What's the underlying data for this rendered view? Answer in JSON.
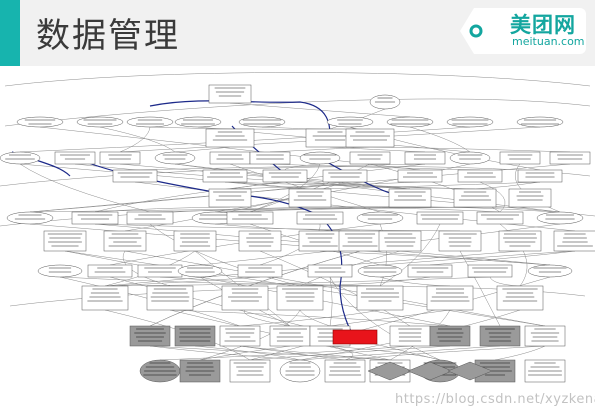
{
  "slide": {
    "title": "数据管理"
  },
  "logo": {
    "name_cn": "美团网",
    "domain": "meituan.com",
    "icon": "meituan-tag-logo-icon"
  },
  "watermark": {
    "text": "https://blog.csdn.net/xyzkenan"
  },
  "colors": {
    "accent_teal": "#17b4ae",
    "highlight_node": "#e8141b",
    "grey_node": "#9a9a9a",
    "edge_blue": "#1d2a8a",
    "edge_grey": "#8c8c8c"
  }
}
